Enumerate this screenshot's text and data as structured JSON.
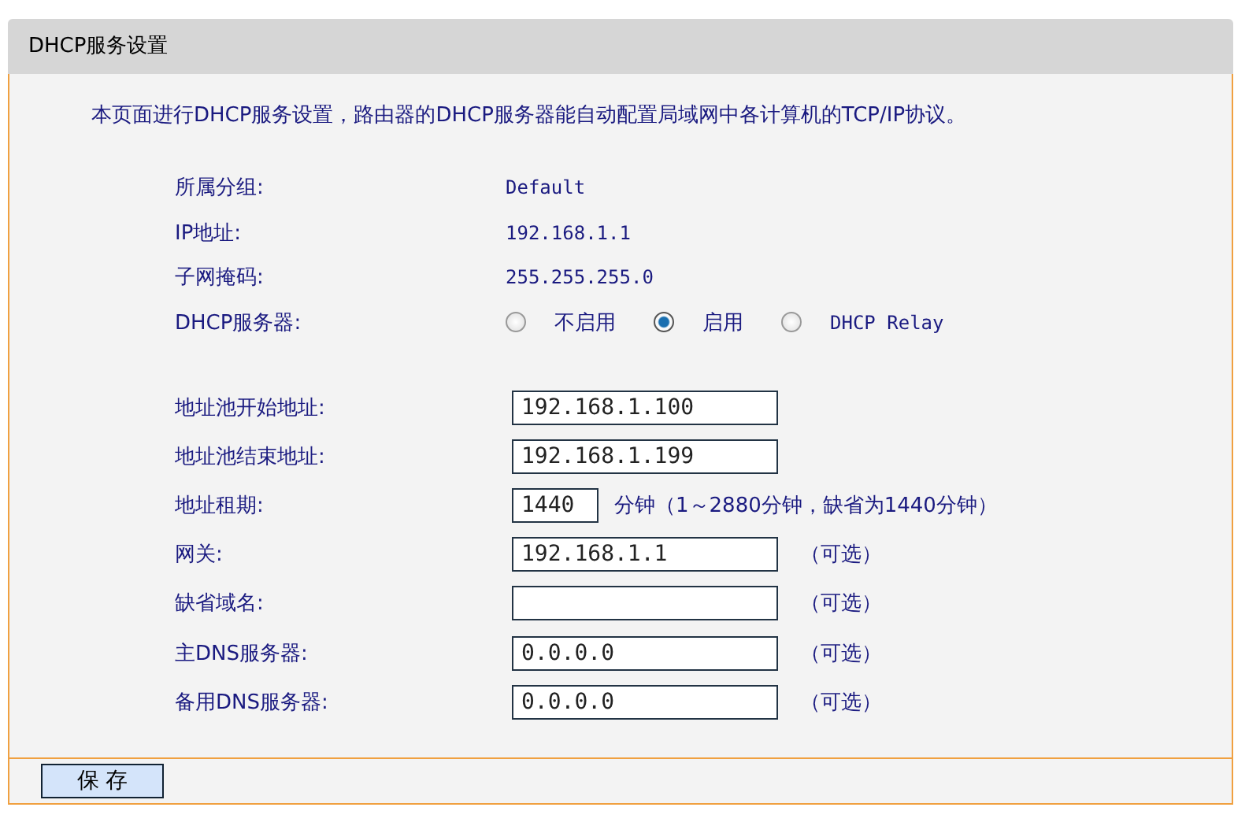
{
  "panel": {
    "title": "DHCP服务设置",
    "intro": "本页面进行DHCP服务设置，路由器的DHCP服务器能自动配置局域网中各计算机的TCP/IP协议。"
  },
  "info_rows": [
    {
      "label": "所属分组:",
      "value": "Default"
    },
    {
      "label": "IP地址:",
      "value": "192.168.1.1"
    },
    {
      "label": "子网掩码:",
      "value": "255.255.255.0"
    }
  ],
  "dhcp_server": {
    "label": "DHCP服务器:",
    "options": [
      {
        "label": "不启用",
        "selected": false
      },
      {
        "label": "启用",
        "selected": true
      },
      {
        "label": "DHCP Relay",
        "selected": false
      }
    ]
  },
  "fields": [
    {
      "kind": "wide",
      "label": "地址池开始地址:",
      "value": "192.168.1.100"
    },
    {
      "kind": "wide",
      "label": "地址池结束地址:",
      "value": "192.168.1.199"
    },
    {
      "kind": "short",
      "label": "地址租期:",
      "value": "1440",
      "note": "分钟（1～2880分钟，缺省为1440分钟）"
    },
    {
      "kind": "wide",
      "label": "网关:",
      "value": "192.168.1.1",
      "note": "（可选）"
    },
    {
      "kind": "wide",
      "label": "缺省域名:",
      "note": "（可选）"
    },
    {
      "kind": "wide",
      "label": "主DNS服务器:",
      "value": "0.0.0.0",
      "note": "（可选）"
    },
    {
      "kind": "wide",
      "label": "备用DNS服务器:",
      "value": "0.0.0.0",
      "note": "（可选）"
    }
  ],
  "buttons": [
    {
      "label": "保 存"
    }
  ]
}
